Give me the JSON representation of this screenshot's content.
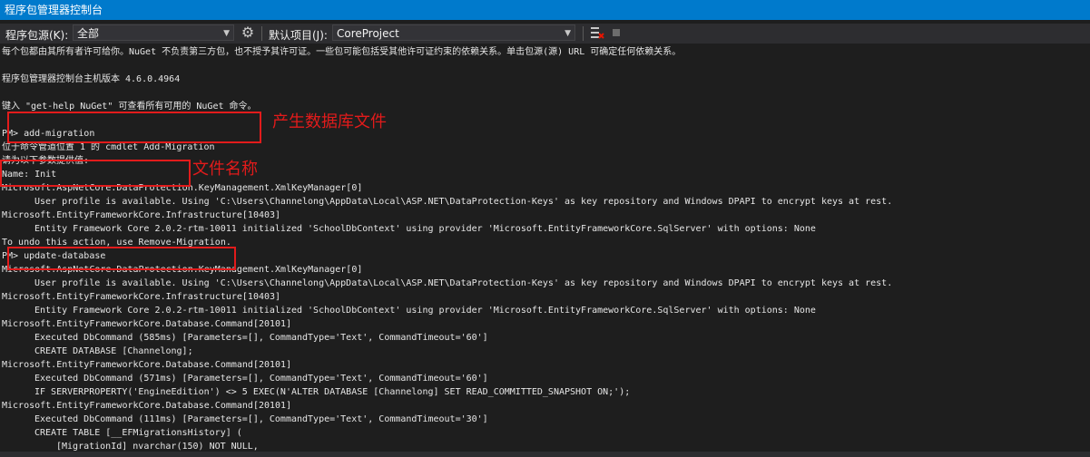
{
  "window": {
    "title": "程序包管理器控制台"
  },
  "toolbar": {
    "source_label": "程序包源(K):",
    "source_value": "全部",
    "project_label": "默认项目(J):",
    "project_value": "CoreProject"
  },
  "console": {
    "lines": [
      "每个包都由其所有者许可给你。NuGet 不负责第三方包，也不授予其许可证。一些包可能包括受其他许可证约束的依赖关系。单击包源(源) URL 可确定任何依赖关系。",
      "程序包管理器控制台主机版本 4.6.0.4964",
      "键入 \"get-help NuGet\" 可查看所有可用的 NuGet 命令。",
      "PM> add-migration",
      "位于命令管道位置 1 的 cmdlet Add-Migration",
      "请为以下参数提供值:",
      "Name: Init",
      "Microsoft.AspNetCore.DataProtection.KeyManagement.XmlKeyManager[0]",
      "User profile is available. Using 'C:\\Users\\Channelong\\AppData\\Local\\ASP.NET\\DataProtection-Keys' as key repository and Windows DPAPI to encrypt keys at rest.",
      "Microsoft.EntityFrameworkCore.Infrastructure[10403]",
      "Entity Framework Core 2.0.2-rtm-10011 initialized 'SchoolDbContext' using provider 'Microsoft.EntityFrameworkCore.SqlServer' with options: None",
      "To undo this action, use Remove-Migration.",
      "PM> update-database",
      "Microsoft.AspNetCore.DataProtection.KeyManagement.XmlKeyManager[0]",
      "User profile is available. Using 'C:\\Users\\Channelong\\AppData\\Local\\ASP.NET\\DataProtection-Keys' as key repository and Windows DPAPI to encrypt keys at rest.",
      "Microsoft.EntityFrameworkCore.Infrastructure[10403]",
      "Entity Framework Core 2.0.2-rtm-10011 initialized 'SchoolDbContext' using provider 'Microsoft.EntityFrameworkCore.SqlServer' with options: None",
      "Microsoft.EntityFrameworkCore.Database.Command[20101]",
      "Executed DbCommand (585ms) [Parameters=[], CommandType='Text', CommandTimeout='60']",
      "CREATE DATABASE [Channelong];",
      "Microsoft.EntityFrameworkCore.Database.Command[20101]",
      "Executed DbCommand (571ms) [Parameters=[], CommandType='Text', CommandTimeout='60']",
      "IF SERVERPROPERTY('EngineEdition') <> 5 EXEC(N'ALTER DATABASE [Channelong] SET READ_COMMITTED_SNAPSHOT ON;');",
      "Microsoft.EntityFrameworkCore.Database.Command[20101]",
      "Executed DbCommand (111ms) [Parameters=[], CommandType='Text', CommandTimeout='30']",
      "CREATE TABLE [__EFMigrationsHistory] (",
      "[MigrationId] nvarchar(150) NOT NULL,"
    ]
  },
  "annotations": {
    "generate_db_file": "产生数据库文件",
    "file_name": "文件名称"
  },
  "colors": {
    "title_bar": "#007acc",
    "background": "#1e1e1e",
    "annotation": "#e21b1b"
  }
}
